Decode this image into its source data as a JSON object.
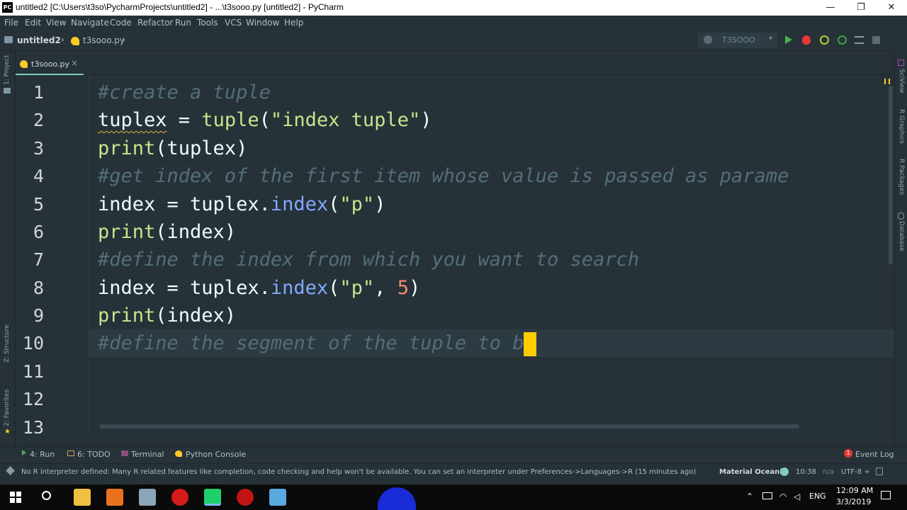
{
  "window": {
    "title": "untitled2 [C:\\Users\\t3so\\PycharmProjects\\untitled2] - ...\\t3sooo.py [untitled2] - PyCharm",
    "logo_text": "PC",
    "minimize": "—",
    "maximize": "❐",
    "close": "✕"
  },
  "menu": [
    "File",
    "Edit",
    "View",
    "Navigate",
    "Code",
    "Refactor",
    "Run",
    "Tools",
    "VCS",
    "Window",
    "Help"
  ],
  "breadcrumb": {
    "project": "untitled2",
    "file": "t3sooo.py"
  },
  "run_config": "T3SOOO",
  "tab": {
    "label": "t3sooo.py",
    "close": "×"
  },
  "left_tools": {
    "project": "1: Project",
    "structure": "Z: Structure",
    "favorites": "2: Favorites"
  },
  "right_tools": [
    "SciView",
    "R Graphics",
    "R Packages",
    "Database"
  ],
  "line_numbers": [
    "1",
    "2",
    "3",
    "4",
    "5",
    "6",
    "7",
    "8",
    "9",
    "10",
    "11",
    "12",
    "13"
  ],
  "code": {
    "l1": "#create a tuple",
    "l2_var": "tuplex",
    "l2_op": " = ",
    "l2_fn": "tuple",
    "l2_open": "(",
    "l2_str": "\"index tuple\"",
    "l2_close": ")",
    "l3_fn": "print",
    "l3_rest": "(tuplex)",
    "l4": "#get index of the first item whose value is passed as parame",
    "l5_a": "index = tuplex.",
    "l5_m": "index",
    "l5_o": "(",
    "l5_s": "\"p\"",
    "l5_c": ")",
    "l6_fn": "print",
    "l6_rest": "(index)",
    "l7": "#define the index from which you want to search",
    "l8_a": "index = tuplex.",
    "l8_m": "index",
    "l8_o": "(",
    "l8_s": "\"p\"",
    "l8_comma": ", ",
    "l8_n": "5",
    "l8_c": ")",
    "l9_fn": "print",
    "l9_rest": "(index)",
    "l10": "#define the segment of the tuple to b"
  },
  "tool_windows": {
    "run": "4: Run",
    "todo": "6: TODO",
    "terminal": "Terminal",
    "console": "Python Console",
    "event_log": "Event Log",
    "event_count": "1"
  },
  "status": {
    "message": "No R interpreter defined: Many R related features like completion, code checking and help won't be available. You can set an interpreter under Preferences->Languages->R (15 minutes ago)",
    "theme": "Material Oceanic",
    "position": "10:38",
    "na": "n/a",
    "encoding": "UTF-8 ÷"
  },
  "taskbar": {
    "lang": "ENG",
    "time": "12:09 AM",
    "date": "3/3/2019"
  },
  "colors": {
    "accent": "#80cbc4",
    "comment": "#546e7a",
    "string": "#c3e88d",
    "number": "#f78c6c",
    "caret": "#ffcc00"
  }
}
